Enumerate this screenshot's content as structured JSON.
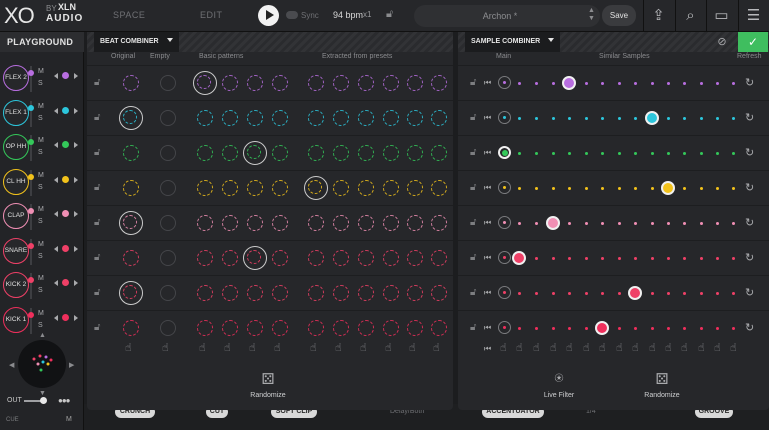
{
  "header": {
    "logo_xo": "XO",
    "logo_by": "BY",
    "logo_xln": "XLN",
    "logo_audio": "AUDIO",
    "tab_space": "SPACE",
    "tab_edit": "EDIT",
    "sync_label": "Sync",
    "bpm": "94 bpm",
    "multiplier": "x1",
    "preset_name": "Archon *",
    "save_label": "Save"
  },
  "left": {
    "title": "PLAYGROUND",
    "out_label": "OUT",
    "cue_label": "CUE",
    "cue_m": "M",
    "tracks": [
      {
        "name": "FLEX 2",
        "color": "#b86ee0"
      },
      {
        "name": "FLEX 1",
        "color": "#2cc6dc"
      },
      {
        "name": "OP HH",
        "color": "#34c85a"
      },
      {
        "name": "CL HH",
        "color": "#f2c21b"
      },
      {
        "name": "CLAP",
        "color": "#f08fb4"
      },
      {
        "name": "SNARE",
        "color": "#ef4067"
      },
      {
        "name": "KICK 2",
        "color": "#ef4067"
      },
      {
        "name": "KICK 1",
        "color": "#ef2f5c"
      }
    ],
    "m": "M",
    "s": "S"
  },
  "beat": {
    "title": "BEAT COMBINER",
    "col_original": "Original",
    "col_empty": "Empty",
    "col_basic": "Basic patterns",
    "col_extracted": "Extracted from presets",
    "randomize": "Randomize"
  },
  "sample": {
    "title": "SAMPLE COMBINER",
    "col_main": "Main",
    "col_similar": "Similar Samples",
    "col_refresh": "Refresh",
    "live_filter": "Live Filter",
    "randomize": "Randomize",
    "selected_index": [
      4,
      9,
      0,
      10,
      3,
      1,
      8,
      6
    ]
  },
  "fx": {
    "crunch": "CRUNCH",
    "cut": "CUT",
    "soft_clip": "SOFT CLIP",
    "delay": "Delay/Both",
    "accentuator": "ACCENTUATOR",
    "ratio": "1/4",
    "groove": "GROOVE"
  },
  "icons": {
    "lock": "lock-icon",
    "hand": "hand-pointer-icon",
    "dice": "dice-icon",
    "refresh": "refresh-icon",
    "share": "share-icon",
    "search": "search-icon",
    "folder": "folder-icon",
    "menu": "menu-icon"
  }
}
